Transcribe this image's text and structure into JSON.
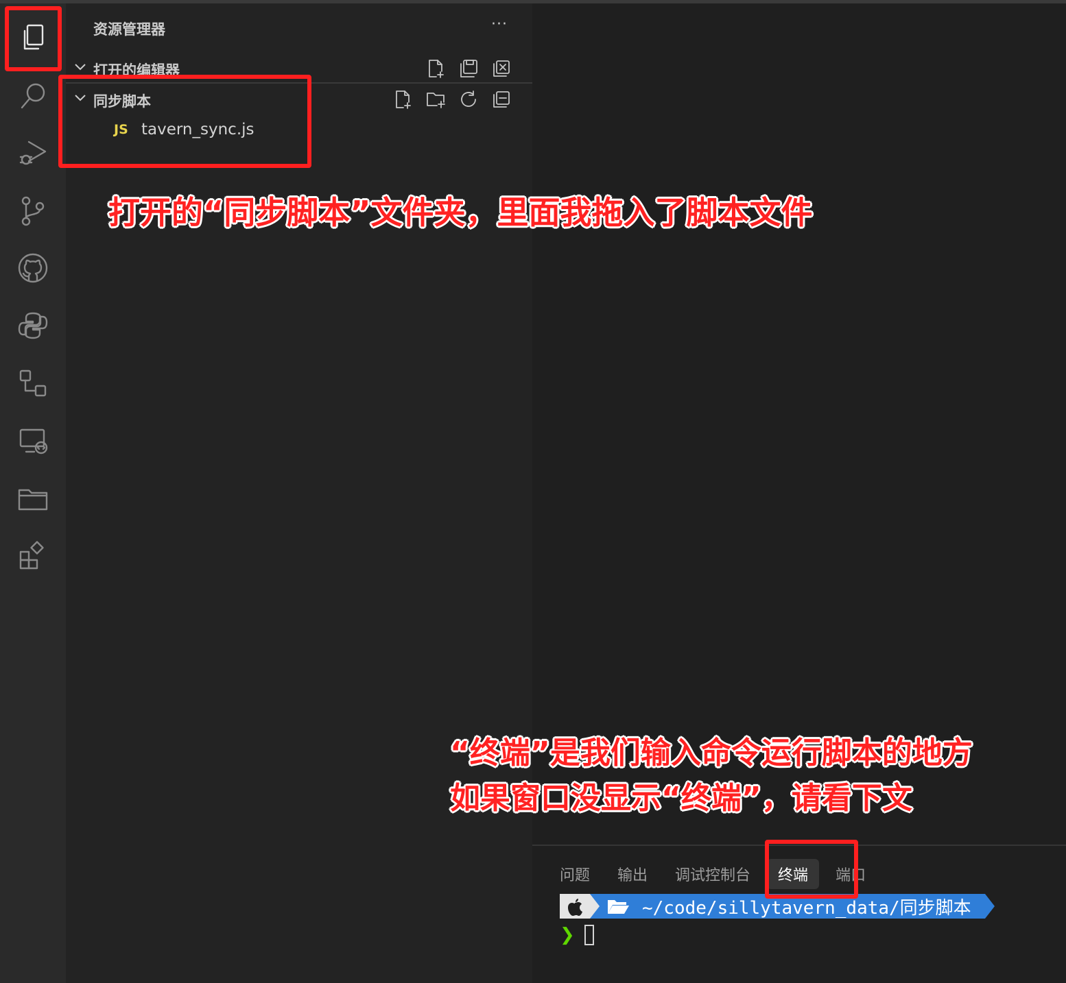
{
  "sidebar": {
    "title": "资源管理器",
    "more": "···",
    "open_editors": {
      "label": "打开的编辑器"
    },
    "folder": {
      "label": "同步脚本",
      "files": [
        {
          "badge": "JS",
          "name": "tavern_sync.js"
        }
      ]
    }
  },
  "activity_bar": {
    "icons": [
      "explorer-icon",
      "search-icon",
      "run-debug-icon",
      "source-control-icon",
      "github-icon",
      "python-icon",
      "workflow-icon",
      "remote-explorer-icon",
      "folder-icon",
      "extensions-icon"
    ]
  },
  "annotations": {
    "folder_note": "打开的“同步脚本”文件夹，里面我拖入了脚本文件",
    "terminal_note_line1": "“终端”是我们输入命令运行脚本的地方",
    "terminal_note_line2": "如果窗口没显示“终端”，请看下文"
  },
  "panel": {
    "tabs": [
      {
        "label": "问题",
        "active": false
      },
      {
        "label": "输出",
        "active": false
      },
      {
        "label": "调试控制台",
        "active": false
      },
      {
        "label": "终端",
        "active": true
      },
      {
        "label": "端口",
        "active": false
      }
    ],
    "terminal": {
      "path": "~/code/sillytavern_data/同步脚本",
      "prompt_symbol": "❯"
    }
  },
  "colors": {
    "annotation_red": "#ff1f1f",
    "js_badge": "#e8d44d",
    "prompt_segment": "#2f7ed8",
    "prompt_caret": "#5fd700"
  }
}
